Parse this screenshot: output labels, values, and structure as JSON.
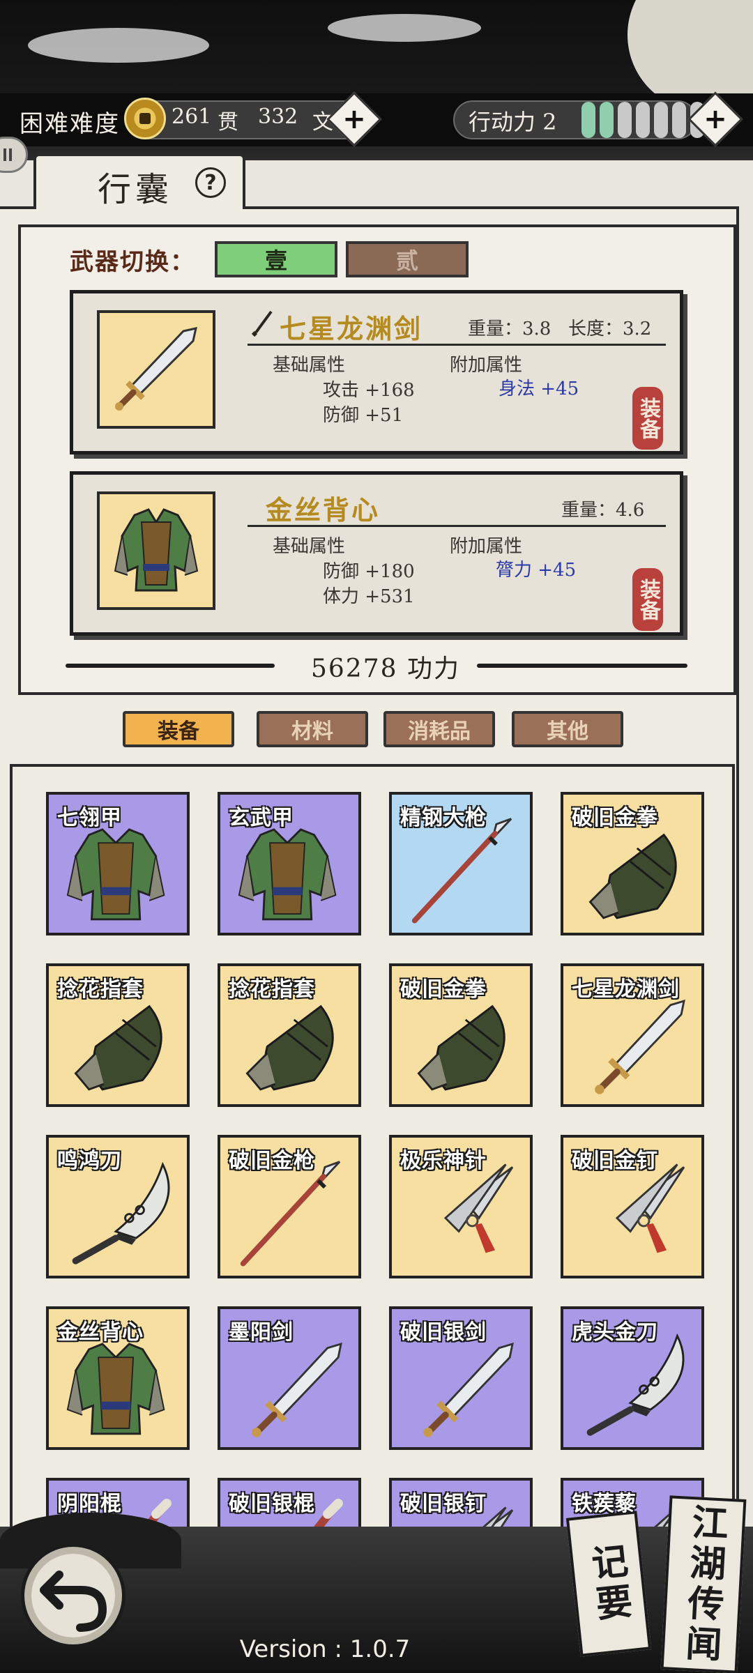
{
  "header": {
    "difficulty": "困难难度",
    "coin_guan_value": "261",
    "coin_guan_unit": "贯",
    "coin_wen_value": "332",
    "coin_wen_unit": "文",
    "stamina_label": "行动力 2",
    "stamina_filled": 2,
    "stamina_total": 7
  },
  "panel": {
    "title": "行囊",
    "help_symbol": "?"
  },
  "weapon_switch": {
    "label": "武器切换：",
    "options": [
      "壹",
      "贰"
    ],
    "selected": "壹"
  },
  "equipped": [
    {
      "name": "七星龙渊剑",
      "weight_text": "重量：3.8",
      "length_text": "长度：3.2",
      "base_label": "基础属性",
      "bonus_label": "附加属性",
      "base_stats": [
        "攻击 +168",
        "防御 +51"
      ],
      "bonus_stats": [
        "身法 +45"
      ],
      "equip_label": "装备"
    },
    {
      "name": "金丝背心",
      "weight_text": "重量：4.6",
      "base_label": "基础属性",
      "bonus_label": "附加属性",
      "base_stats": [
        "防御 +180",
        "体力 +531"
      ],
      "bonus_stats": [
        "膂力 +45"
      ],
      "equip_label": "装备"
    }
  ],
  "power": "56278 功力",
  "filter_tabs": [
    "装备",
    "材料",
    "消耗品",
    "其他"
  ],
  "filter_selected": "装备",
  "inventory": [
    {
      "name": "七翎甲",
      "kind": "armor",
      "rarity": "purple"
    },
    {
      "name": "玄武甲",
      "kind": "armor",
      "rarity": "purple"
    },
    {
      "name": "精钢大枪",
      "kind": "spear",
      "rarity": "blue"
    },
    {
      "name": "破旧金拳",
      "kind": "gauntlet",
      "rarity": "yellow"
    },
    {
      "name": "捻花指套",
      "kind": "gauntlet",
      "rarity": "yellow"
    },
    {
      "name": "捻花指套",
      "kind": "gauntlet",
      "rarity": "yellow"
    },
    {
      "name": "破旧金拳",
      "kind": "gauntlet",
      "rarity": "yellow"
    },
    {
      "name": "七星龙渊剑",
      "kind": "sword",
      "rarity": "yellow"
    },
    {
      "name": "鸣鸿刀",
      "kind": "saber",
      "rarity": "yellow"
    },
    {
      "name": "破旧金枪",
      "kind": "spear",
      "rarity": "yellow"
    },
    {
      "name": "极乐神针",
      "kind": "dart",
      "rarity": "yellow"
    },
    {
      "name": "破旧金钉",
      "kind": "dart",
      "rarity": "yellow"
    },
    {
      "name": "金丝背心",
      "kind": "armor",
      "rarity": "yellow"
    },
    {
      "name": "墨阳剑",
      "kind": "sword",
      "rarity": "purple"
    },
    {
      "name": "破旧银剑",
      "kind": "sword",
      "rarity": "purple"
    },
    {
      "name": "虎头金刀",
      "kind": "saber",
      "rarity": "purple"
    },
    {
      "name": "阴阳棍",
      "kind": "staff",
      "rarity": "purple"
    },
    {
      "name": "破旧银棍",
      "kind": "staff",
      "rarity": "purple"
    },
    {
      "name": "破旧银钉",
      "kind": "dart",
      "rarity": "purple"
    },
    {
      "name": "铁蒺藜",
      "kind": "dart",
      "rarity": "purple"
    }
  ],
  "bottom": {
    "version": "Version : 1.0.7",
    "scroll_left": "记要",
    "scroll_right": "江湖传闻"
  },
  "colors": {
    "purple": "#a99ae8",
    "blue": "#b3d9f2",
    "yellow": "#f6dfa0",
    "switch_selected": "#7fcf7a",
    "switch_unselected": "#8b6a55",
    "tab_selected": "#f2b24e",
    "tab_unselected": "#9a7058",
    "stamina_on": "#8fcfae",
    "stamina_off": "#c9c9c9"
  }
}
